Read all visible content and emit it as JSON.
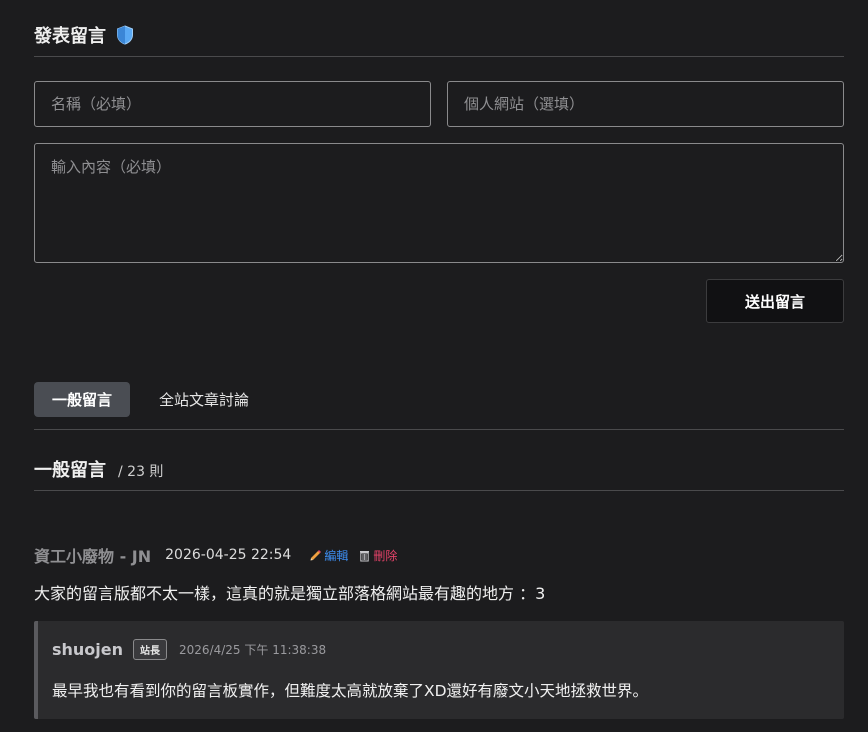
{
  "form": {
    "title": "發表留言",
    "name_placeholder": "名稱（必填）",
    "site_placeholder": "個人網站（選填）",
    "content_placeholder": "輸入內容（必填）",
    "submit_label": "送出留言"
  },
  "tabs": [
    {
      "label": "一般留言",
      "active": true
    },
    {
      "label": "全站文章討論",
      "active": false
    }
  ],
  "list": {
    "title": "一般留言",
    "count": "/ 23 則"
  },
  "comment": {
    "author": "資工小廢物 - JN",
    "date": "2026-04-25 22:54",
    "edit_label": "編輯",
    "delete_label": "刪除",
    "body": "大家的留言版都不太一樣，這真的就是獨立部落格網站最有趣的地方 ：3"
  },
  "reply": {
    "author": "shuojen",
    "badge": "站長",
    "date": "2026/4/25 下午 11:38:38",
    "body": "最早我也有看到你的留言板實作，但難度太高就放棄了XD還好有廢文小天地拯救世界。"
  },
  "colors": {
    "background": "#1c1c1e",
    "edit": "#3d8df0",
    "delete": "#e8436a",
    "reply_bg": "#2b2b2d"
  },
  "icons": [
    "shield-icon",
    "pencil-icon",
    "trash-icon"
  ]
}
